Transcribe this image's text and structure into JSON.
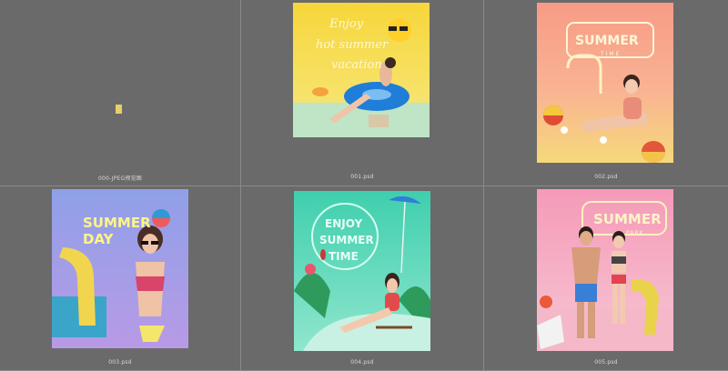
{
  "files": [
    {
      "label": "000-JPEG预览图"
    },
    {
      "label": "001.psd",
      "thumb_text": [
        "Enjoy",
        "hot summer",
        "vacation"
      ]
    },
    {
      "label": "002.psd",
      "thumb_text": [
        "SUMMER",
        "TIME"
      ]
    },
    {
      "label": "003.psd",
      "thumb_text": [
        "SUMMER",
        "DAY"
      ]
    },
    {
      "label": "004.psd",
      "thumb_text": [
        "ENJOY",
        "SUMMER",
        "TIME"
      ]
    },
    {
      "label": "005.psd",
      "thumb_text": [
        "SUMMER",
        "PARK"
      ]
    }
  ]
}
